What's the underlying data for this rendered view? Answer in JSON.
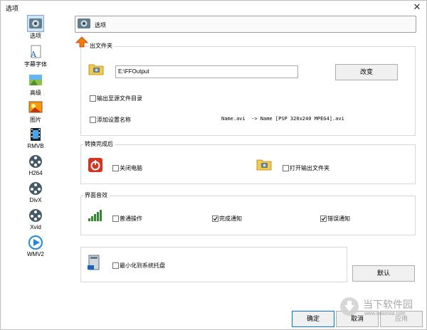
{
  "window": {
    "title": "选项",
    "close_glyph": "✕"
  },
  "sidebar": {
    "items": [
      {
        "label": "选项",
        "icon": "options-icon"
      },
      {
        "label": "字幕字体",
        "icon": "subtitle-font-icon"
      },
      {
        "label": "高级",
        "icon": "advanced-icon"
      },
      {
        "label": "图片",
        "icon": "picture-icon"
      },
      {
        "label": "RMVB",
        "icon": "rmvb-film-icon"
      },
      {
        "label": "H264",
        "icon": "h264-reel-icon"
      },
      {
        "label": "DivX",
        "icon": "divx-reel-icon"
      },
      {
        "label": "Xvid",
        "icon": "xvid-reel-icon"
      },
      {
        "label": "WMV2",
        "icon": "wmv2-icon"
      }
    ]
  },
  "header": {
    "title": "选项"
  },
  "output_folder": {
    "group_title": "出文件夹",
    "path_value": "E:\\FFOutput",
    "change_button": "改变",
    "output_to_source": "输出至源文件目录",
    "add_settings_name": "添加设置名称",
    "example_text": "Name.avi  -> Name [PSP 320x240 MPEG4].avi"
  },
  "after_convert": {
    "group_title": "转换完成后",
    "shutdown": "关闭电脑",
    "open_output_folder": "打开输出文件夹"
  },
  "sound": {
    "group_title": "界面音效",
    "normal_op": "普通操作",
    "complete_notify": "完成通知",
    "error_notify": "错误通知",
    "complete_checked": true,
    "error_checked": true
  },
  "tray": {
    "minimize_to_tray": "最小化到系统托盘"
  },
  "buttons": {
    "default": "默认",
    "ok": "确定",
    "cancel": "取消",
    "apply": "应用"
  },
  "watermark": {
    "text": "当下软件园",
    "url": "www.downxia.com"
  },
  "colors": {
    "accent": "#e07b00",
    "shutdown_red": "#d9331f",
    "check_green": "#2e8b2e"
  }
}
